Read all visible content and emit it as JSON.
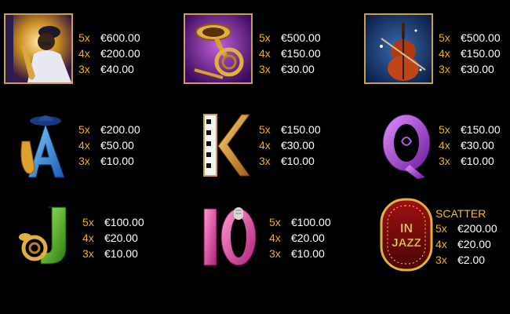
{
  "symbols": [
    {
      "name": "saxophonist",
      "pays": [
        {
          "mult": "5x",
          "amt": "€600.00"
        },
        {
          "mult": "4x",
          "amt": "€200.00"
        },
        {
          "mult": "3x",
          "amt": "€40.00"
        }
      ]
    },
    {
      "name": "horn",
      "pays": [
        {
          "mult": "5x",
          "amt": "€500.00"
        },
        {
          "mult": "4x",
          "amt": "€150.00"
        },
        {
          "mult": "3x",
          "amt": "€30.00"
        }
      ]
    },
    {
      "name": "cello",
      "pays": [
        {
          "mult": "5x",
          "amt": "€500.00"
        },
        {
          "mult": "4x",
          "amt": "€150.00"
        },
        {
          "mult": "3x",
          "amt": "€30.00"
        }
      ]
    },
    {
      "name": "A",
      "pays": [
        {
          "mult": "5x",
          "amt": "€200.00"
        },
        {
          "mult": "4x",
          "amt": "€50.00"
        },
        {
          "mult": "3x",
          "amt": "€10.00"
        }
      ]
    },
    {
      "name": "K",
      "pays": [
        {
          "mult": "5x",
          "amt": "€150.00"
        },
        {
          "mult": "4x",
          "amt": "€30.00"
        },
        {
          "mult": "3x",
          "amt": "€10.00"
        }
      ]
    },
    {
      "name": "Q",
      "pays": [
        {
          "mult": "5x",
          "amt": "€150.00"
        },
        {
          "mult": "4x",
          "amt": "€30.00"
        },
        {
          "mult": "3x",
          "amt": "€10.00"
        }
      ]
    },
    {
      "name": "J",
      "pays": [
        {
          "mult": "5x",
          "amt": "€100.00"
        },
        {
          "mult": "4x",
          "amt": "€20.00"
        },
        {
          "mult": "3x",
          "amt": "€10.00"
        }
      ]
    },
    {
      "name": "10",
      "pays": [
        {
          "mult": "5x",
          "amt": "€100.00"
        },
        {
          "mult": "4x",
          "amt": "€20.00"
        },
        {
          "mult": "3x",
          "amt": "€10.00"
        }
      ]
    },
    {
      "name": "scatter",
      "label": "SCATTER",
      "logo_text": "IN JAZZ",
      "pays": [
        {
          "mult": "5x",
          "amt": "€200.00"
        },
        {
          "mult": "4x",
          "amt": "€20.00"
        },
        {
          "mult": "3x",
          "amt": "€2.00"
        }
      ]
    }
  ],
  "colors": {
    "multiplier": "#f0b400",
    "amount": "#ffffff",
    "background": "#000000",
    "scatter_label": "#f0c020"
  }
}
